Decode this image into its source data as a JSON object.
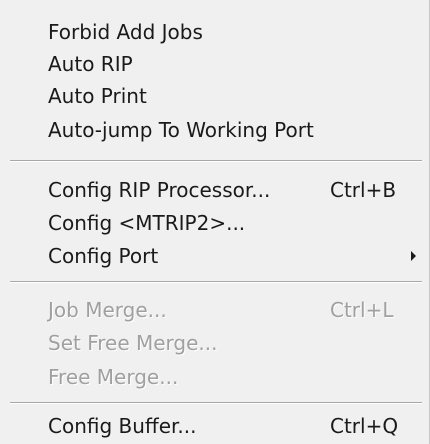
{
  "menu": {
    "group1": [
      {
        "label": "Forbid Add Jobs"
      },
      {
        "label": "Auto RIP"
      },
      {
        "label": "Auto Print"
      },
      {
        "label": "Auto-jump To Working Port"
      }
    ],
    "group2": [
      {
        "label": "Config RIP Processor...",
        "shortcut": "Ctrl+B"
      },
      {
        "label": "Config <MTRIP2>..."
      },
      {
        "label": "Config Port",
        "submenu_icon": "submenu-arrow-icon"
      }
    ],
    "group3": [
      {
        "label": "Job Merge...",
        "shortcut": "Ctrl+L",
        "enabled": false
      },
      {
        "label": "Set Free Merge...",
        "enabled": false
      },
      {
        "label": "Free Merge...",
        "enabled": false
      }
    ],
    "group4": [
      {
        "label": "Config Buffer...",
        "shortcut": "Ctrl+Q"
      }
    ]
  },
  "colors": {
    "background": "#f0f0f0",
    "text": "#1a1a1a",
    "disabled_text": "#a0a0a0"
  }
}
